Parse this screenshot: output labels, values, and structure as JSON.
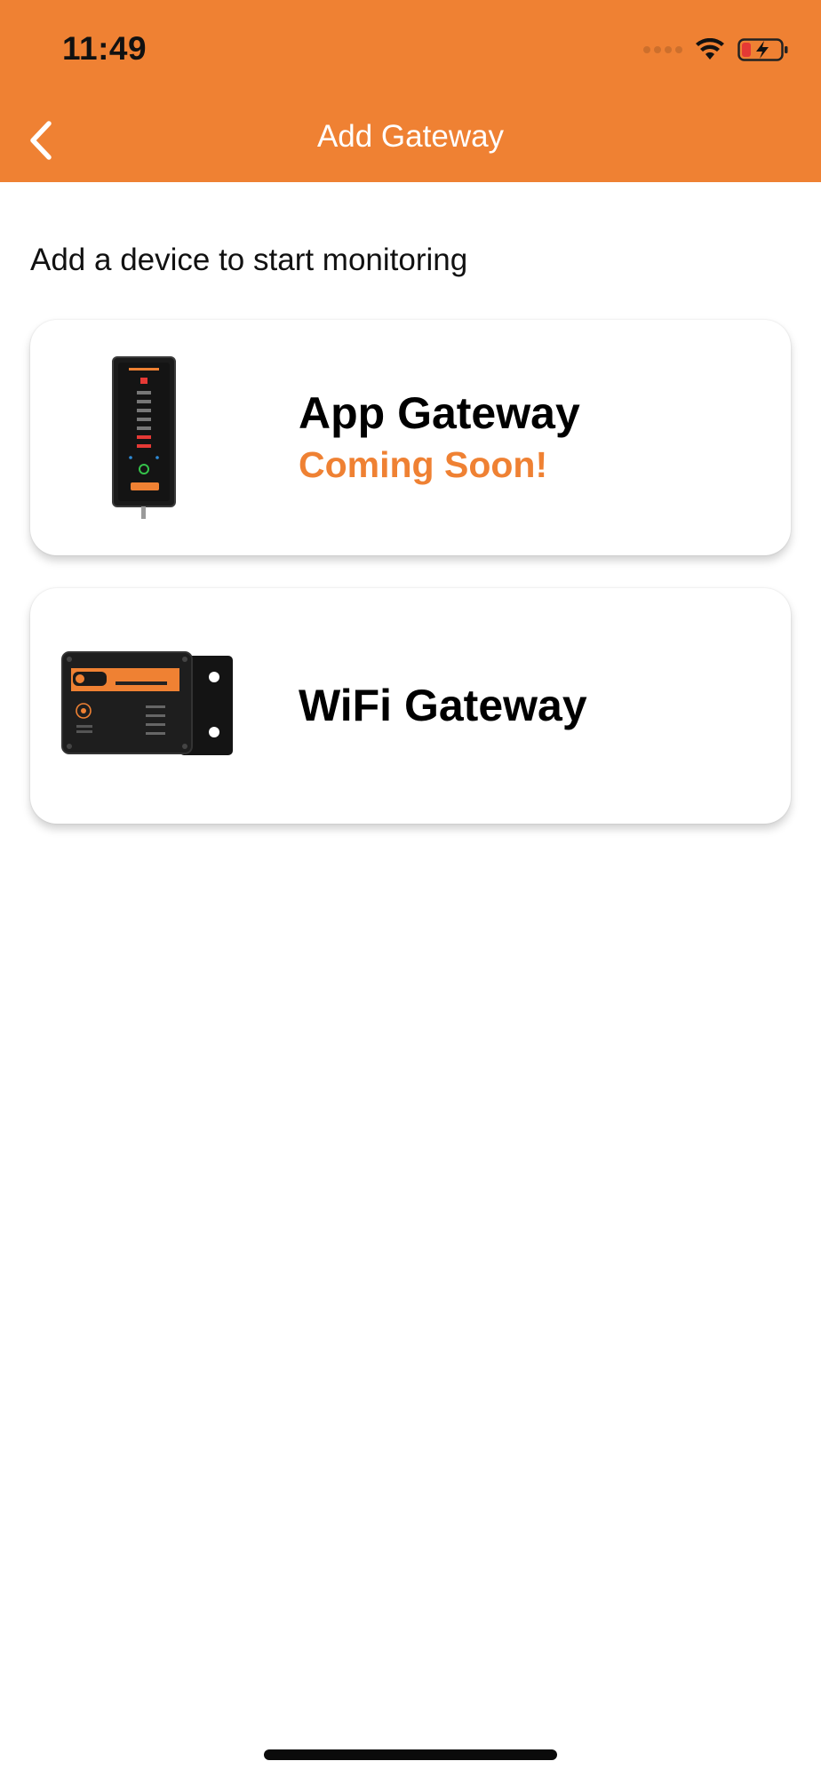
{
  "status_bar": {
    "time": "11:49",
    "icons": [
      "cellular-signal-icon",
      "wifi-icon",
      "battery-charging-icon"
    ]
  },
  "nav": {
    "title": "Add Gateway",
    "back_icon": "chevron-left-icon"
  },
  "main": {
    "subtitle": "Add a device to start monitoring",
    "devices": [
      {
        "title": "App Gateway",
        "status": "Coming Soon!",
        "image": "app-gateway-device"
      },
      {
        "title": "WiFi Gateway",
        "image": "wifi-gateway-device"
      }
    ]
  },
  "colors": {
    "accent": "#ef8133",
    "header_text": "#ffffff",
    "battery_low": "#e53935"
  }
}
